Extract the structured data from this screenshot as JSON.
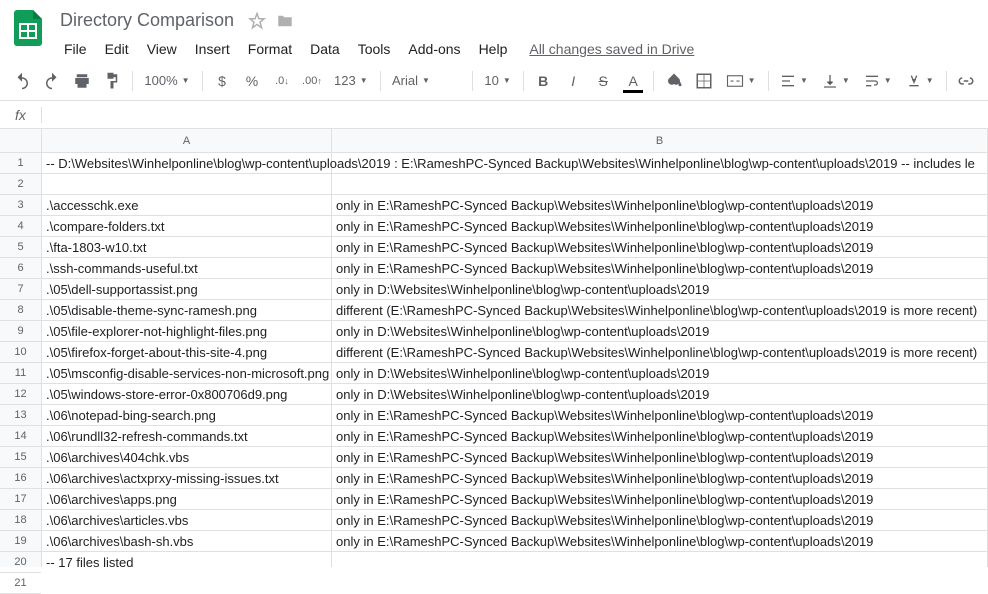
{
  "doc_title": "Directory Comparison",
  "menubar": [
    "File",
    "Edit",
    "View",
    "Insert",
    "Format",
    "Data",
    "Tools",
    "Add-ons",
    "Help"
  ],
  "save_status": "All changes saved in Drive",
  "toolbar": {
    "zoom": "100%",
    "font": "Arial",
    "font_size": "10",
    "number_format": "123"
  },
  "columns": [
    "A",
    "B"
  ],
  "row_numbers": [
    "1",
    "2",
    "3",
    "4",
    "5",
    "6",
    "7",
    "8",
    "9",
    "10",
    "11",
    "12",
    "13",
    "14",
    "15",
    "16",
    "17",
    "18",
    "19",
    "20",
    "21"
  ],
  "rows": [
    {
      "a": "-- D:\\Websites\\Winhelponline\\blog\\wp-content\\uploads\\2019 : E:\\RameshPC-Synced Backup\\Websites\\Winhelponline\\blog\\wp-content\\uploads\\2019 -- includes le",
      "b": ""
    },
    {
      "a": "",
      "b": ""
    },
    {
      "a": ".\\accesschk.exe",
      "b": "only in E:\\RameshPC-Synced Backup\\Websites\\Winhelponline\\blog\\wp-content\\uploads\\2019"
    },
    {
      "a": ".\\compare-folders.txt",
      "b": "only in E:\\RameshPC-Synced Backup\\Websites\\Winhelponline\\blog\\wp-content\\uploads\\2019"
    },
    {
      "a": ".\\fta-1803-w10.txt",
      "b": "only in E:\\RameshPC-Synced Backup\\Websites\\Winhelponline\\blog\\wp-content\\uploads\\2019"
    },
    {
      "a": ".\\ssh-commands-useful.txt",
      "b": "only in E:\\RameshPC-Synced Backup\\Websites\\Winhelponline\\blog\\wp-content\\uploads\\2019"
    },
    {
      "a": ".\\05\\dell-supportassist.png",
      "b": "only in D:\\Websites\\Winhelponline\\blog\\wp-content\\uploads\\2019"
    },
    {
      "a": ".\\05\\disable-theme-sync-ramesh.png",
      "b": "different (E:\\RameshPC-Synced Backup\\Websites\\Winhelponline\\blog\\wp-content\\uploads\\2019 is more recent)"
    },
    {
      "a": ".\\05\\file-explorer-not-highlight-files.png",
      "b": "only in D:\\Websites\\Winhelponline\\blog\\wp-content\\uploads\\2019"
    },
    {
      "a": ".\\05\\firefox-forget-about-this-site-4.png",
      "b": "different (E:\\RameshPC-Synced Backup\\Websites\\Winhelponline\\blog\\wp-content\\uploads\\2019 is more recent)"
    },
    {
      "a": ".\\05\\msconfig-disable-services-non-microsoft.png",
      "b": "only in D:\\Websites\\Winhelponline\\blog\\wp-content\\uploads\\2019"
    },
    {
      "a": ".\\05\\windows-store-error-0x800706d9.png",
      "b": "only in D:\\Websites\\Winhelponline\\blog\\wp-content\\uploads\\2019"
    },
    {
      "a": ".\\06\\notepad-bing-search.png",
      "b": "only in E:\\RameshPC-Synced Backup\\Websites\\Winhelponline\\blog\\wp-content\\uploads\\2019"
    },
    {
      "a": ".\\06\\rundll32-refresh-commands.txt",
      "b": "only in E:\\RameshPC-Synced Backup\\Websites\\Winhelponline\\blog\\wp-content\\uploads\\2019"
    },
    {
      "a": ".\\06\\archives\\404chk.vbs",
      "b": "only in E:\\RameshPC-Synced Backup\\Websites\\Winhelponline\\blog\\wp-content\\uploads\\2019"
    },
    {
      "a": ".\\06\\archives\\actxprxy-missing-issues.txt",
      "b": "only in E:\\RameshPC-Synced Backup\\Websites\\Winhelponline\\blog\\wp-content\\uploads\\2019"
    },
    {
      "a": ".\\06\\archives\\apps.png",
      "b": "only in E:\\RameshPC-Synced Backup\\Websites\\Winhelponline\\blog\\wp-content\\uploads\\2019"
    },
    {
      "a": ".\\06\\archives\\articles.vbs",
      "b": "only in E:\\RameshPC-Synced Backup\\Websites\\Winhelponline\\blog\\wp-content\\uploads\\2019"
    },
    {
      "a": ".\\06\\archives\\bash-sh.vbs",
      "b": "only in E:\\RameshPC-Synced Backup\\Websites\\Winhelponline\\blog\\wp-content\\uploads\\2019"
    },
    {
      "a": "-- 17 files listed",
      "b": ""
    },
    {
      "a": "",
      "b": ""
    }
  ]
}
